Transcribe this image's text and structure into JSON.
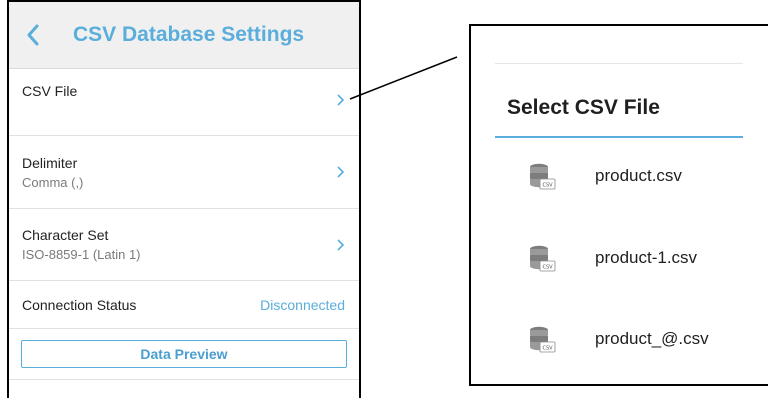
{
  "header": {
    "title": "CSV Database Settings"
  },
  "settings": {
    "csv_file": {
      "title": "CSV File"
    },
    "delimiter": {
      "title": "Delimiter",
      "value": "Comma (,)"
    },
    "charset": {
      "title": "Character Set",
      "value": "ISO-8859-1 (Latin 1)"
    },
    "status": {
      "title": "Connection Status",
      "value": "Disconnected"
    },
    "preview_label": "Data Preview"
  },
  "dialog": {
    "title": "Select CSV File",
    "files": [
      {
        "name": "product.csv",
        "icon": "database-csv-icon"
      },
      {
        "name": "product-1.csv",
        "icon": "database-csv-icon"
      },
      {
        "name": "product_@.csv",
        "icon": "database-csv-icon"
      }
    ]
  },
  "colors": {
    "accent": "#5aaedb",
    "header_bg": "#f0f0f0"
  }
}
